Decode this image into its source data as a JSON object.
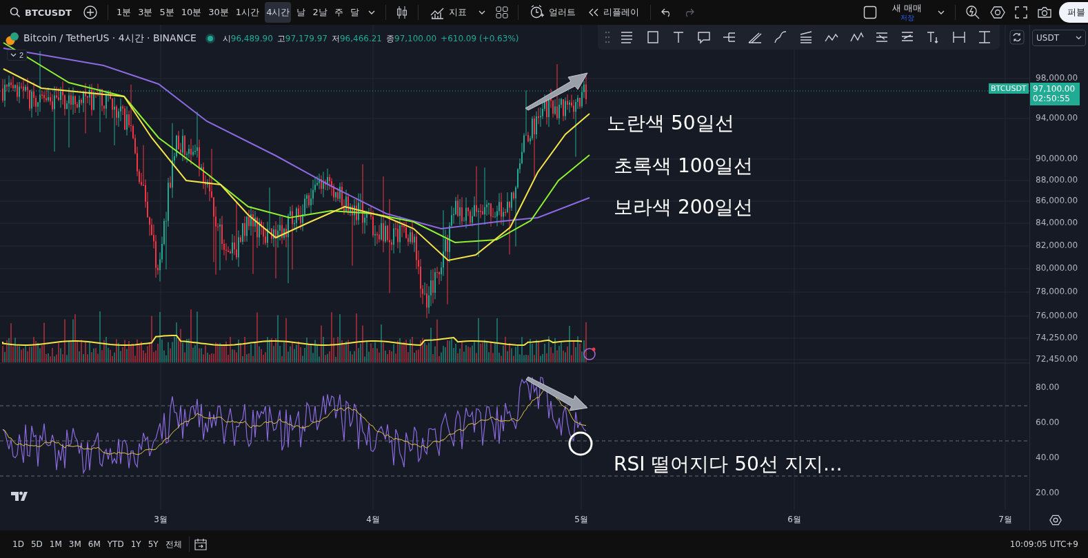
{
  "toolbar": {
    "symbol": "BTCUSDT",
    "intervals": [
      {
        "label": "1분",
        "selected": false
      },
      {
        "label": "3분",
        "selected": false
      },
      {
        "label": "5분",
        "selected": false
      },
      {
        "label": "10분",
        "selected": false
      },
      {
        "label": "30분",
        "selected": false
      },
      {
        "label": "1시간",
        "selected": false
      },
      {
        "label": "4시간",
        "selected": true
      },
      {
        "label": "날",
        "selected": false
      },
      {
        "label": "2날",
        "selected": false
      },
      {
        "label": "주",
        "selected": false
      },
      {
        "label": "달",
        "selected": false
      }
    ],
    "indicators_label": "지표",
    "alert_label": "얼러트",
    "replay_label": "리플레이",
    "trade_label": "새 매매",
    "trade_sublabel": "저장",
    "publish_label": "퍼블"
  },
  "legend": {
    "title": "Bitcoin / TetherUS · 4시간 · BINANCE",
    "ohlc": [
      {
        "label": "시",
        "value": "96,489.90"
      },
      {
        "label": "고",
        "value": "97,179.97"
      },
      {
        "label": "저",
        "value": "96,466.21"
      },
      {
        "label": "종",
        "value": "97,100.00"
      }
    ],
    "change": "+610.09 (+0.63%)",
    "collapsed_count": "2"
  },
  "currency_select": {
    "value": "USDT"
  },
  "price_axis": {
    "ticks": [
      "98,000.00",
      "94,000.00",
      "90,000.00",
      "88,000.00",
      "86,000.00",
      "84,000.00",
      "82,000.00",
      "80,000.00",
      "78,000.00",
      "76,000.00",
      "74,250.00",
      "72,450.00"
    ],
    "symbol_tag": "BTCUSDT",
    "last_price": "97,100.00",
    "countdown": "02:50:55"
  },
  "rsi_axis": {
    "ticks": [
      "80.00",
      "60.00",
      "40.00",
      "20.00"
    ]
  },
  "time_axis": {
    "ticks": [
      "3월",
      "4월",
      "5월",
      "6월",
      "7월"
    ]
  },
  "annotations": [
    "노란색 50일선",
    "초록색 100일선",
    "보라색 200일선",
    "RSI 떨어지다 50선 지지…"
  ],
  "bottom_bar": {
    "ranges": [
      "1D",
      "5D",
      "1M",
      "3M",
      "6M",
      "YTD",
      "1Y",
      "5Y",
      "전체"
    ],
    "clock": "10:09:05 UTC+9"
  }
}
